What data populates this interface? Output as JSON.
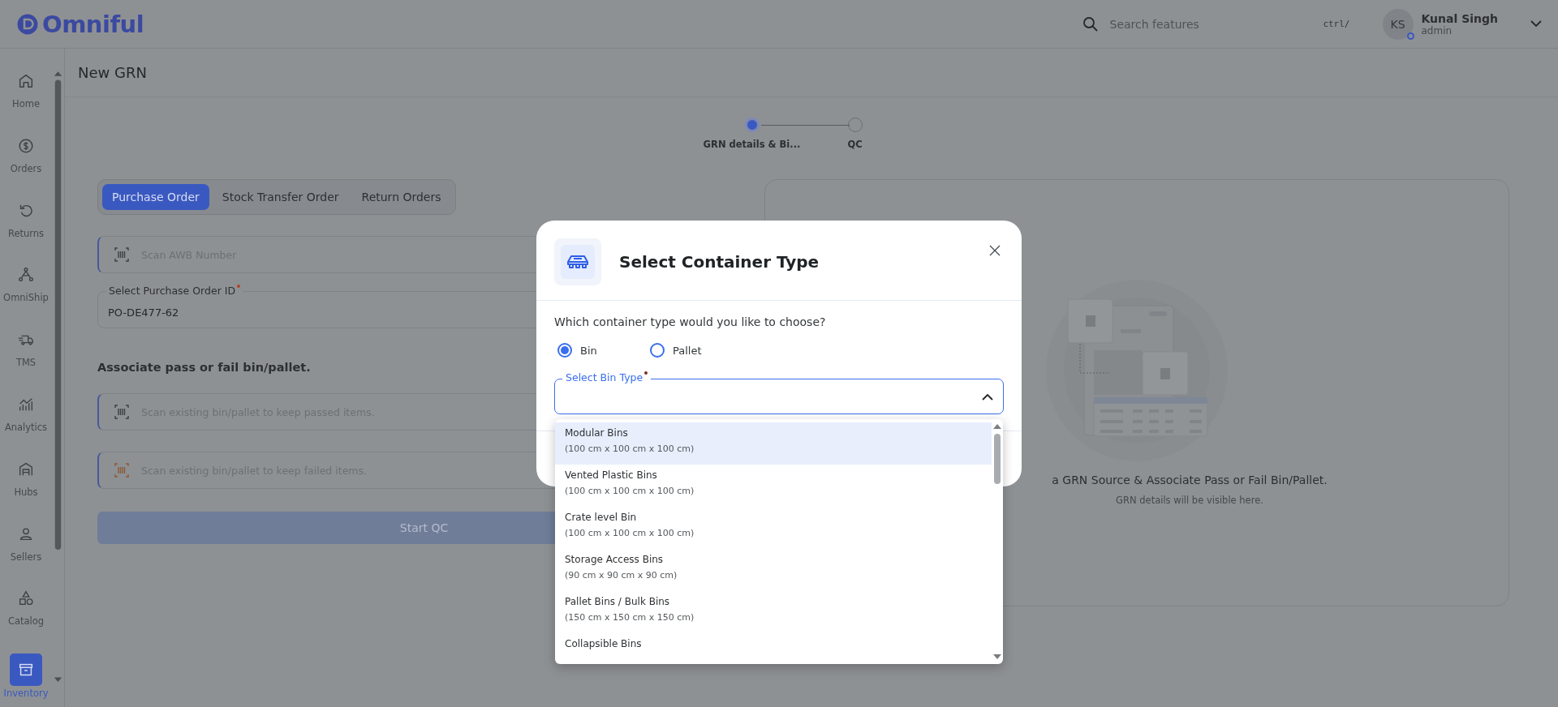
{
  "top_bar": {
    "logo": "Omniful",
    "search": {
      "placeholder": "Search features",
      "shortcut": "ctrl/"
    },
    "user": {
      "initials": "KS",
      "name": "Kunal Singh",
      "role": "admin"
    }
  },
  "sidebar": {
    "items": [
      {
        "label": "Home",
        "selected": false
      },
      {
        "label": "Orders",
        "selected": false
      },
      {
        "label": "Returns",
        "selected": false
      },
      {
        "label": "OmniShip",
        "selected": false
      },
      {
        "label": "TMS",
        "selected": false
      },
      {
        "label": "Analytics",
        "selected": false
      },
      {
        "label": "Hubs",
        "selected": false
      },
      {
        "label": "Sellers",
        "selected": false
      },
      {
        "label": "Catalog",
        "selected": false
      },
      {
        "label": "Inventory",
        "selected": true
      }
    ]
  },
  "page": {
    "title": "New GRN"
  },
  "stepper": {
    "steps": [
      {
        "label": "GRN details & Bi...",
        "active": true
      },
      {
        "label": "QC",
        "active": false
      }
    ]
  },
  "source_tabs": [
    {
      "label": "Purchase Order",
      "selected": true
    },
    {
      "label": "Stock Transfer Order",
      "selected": false
    },
    {
      "label": "Return Orders",
      "selected": false
    }
  ],
  "awb_field": {
    "placeholder": "Scan AWB Number"
  },
  "purchase_order_field": {
    "label": "Select Purchase Order ID",
    "required": true,
    "value": "PO-DE477-62"
  },
  "section_title": "Associate pass or fail bin/pallet.",
  "bin_fields": [
    {
      "kind": "pass",
      "placeholder": "Scan existing bin/pallet to keep passed items."
    },
    {
      "kind": "fail",
      "placeholder": "Scan existing bin/pallet to keep failed items."
    }
  ],
  "start_button": {
    "label": "Start QC",
    "disabled": true
  },
  "details_panel": {
    "title": "a GRN Source & Associate Pass or Fail Bin/Pallet.",
    "subtitle": "GRN details will be visible here."
  },
  "modal": {
    "title": "Select Container Type",
    "question": "Which container type would you like to choose?",
    "container_types": [
      {
        "label": "Bin",
        "selected": true
      },
      {
        "label": "Pallet",
        "selected": false
      }
    ],
    "bin_type_field": {
      "label": "Select Bin Type",
      "required": true,
      "expanded": true
    },
    "options": [
      {
        "name": "Modular Bins",
        "size": "(100 cm x 100 cm x 100 cm)",
        "highlighted": true
      },
      {
        "name": "Vented Plastic Bins",
        "size": "(100 cm x 100 cm x 100 cm)",
        "highlighted": false
      },
      {
        "name": "Crate level Bin",
        "size": "(100 cm x 100 cm x 100 cm)",
        "highlighted": false
      },
      {
        "name": "Storage Access Bins",
        "size": "(90 cm x 90 cm x 90 cm)",
        "highlighted": false
      },
      {
        "name": "Pallet Bins / Bulk Bins",
        "size": "(150 cm x 150 cm x 150 cm)",
        "highlighted": false
      },
      {
        "name": "Collapsible Bins",
        "highlighted": false
      }
    ]
  }
}
